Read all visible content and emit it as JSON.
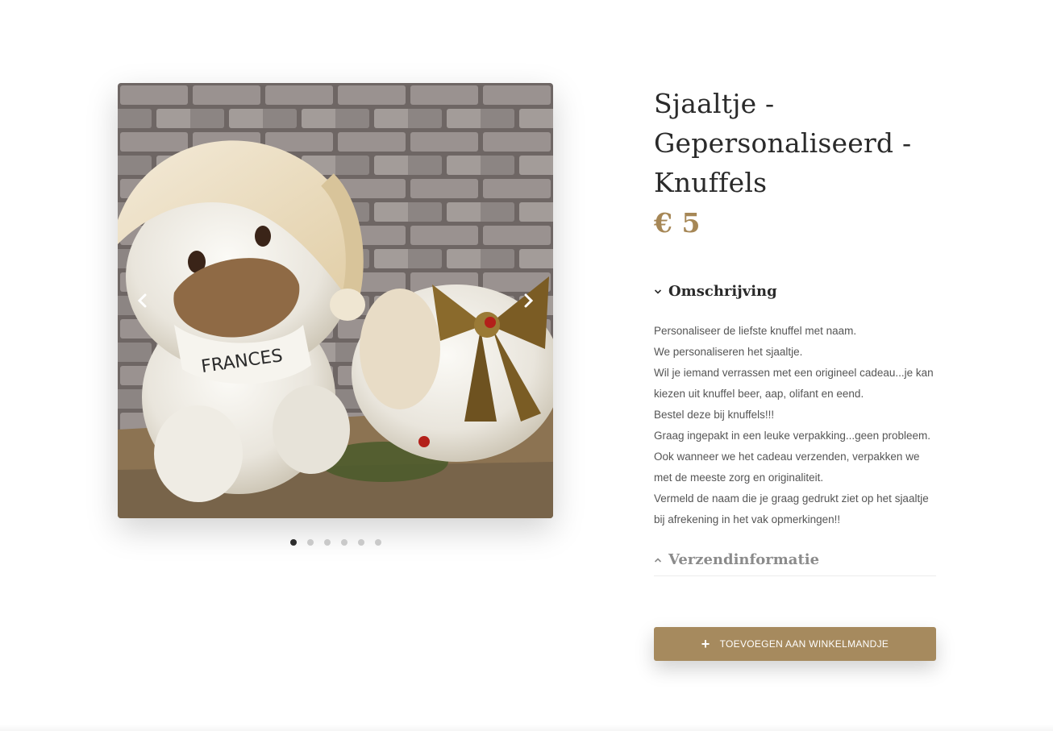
{
  "product": {
    "title_lines": [
      "Sjaaltje -",
      "Gepersonaliseerd -",
      "Knuffels"
    ],
    "price": "€ 5"
  },
  "gallery": {
    "image_text": "FRANCES",
    "active_index": 0,
    "dot_count": 6,
    "prev_icon": "chevron-left-icon",
    "next_icon": "chevron-right-icon"
  },
  "description": {
    "heading": "Omschrijving",
    "expanded": true,
    "lines": [
      "Personaliseer de liefste knuffel met naam.",
      "We personaliseren het sjaaltje.",
      "Wil je iemand verrassen met een origineel cadeau...je kan kiezen uit knuffel beer, aap, olifant en eend.",
      "Bestel deze bij knuffels!!!",
      "Graag ingepakt in een leuke verpakking...geen probleem. Ook wanneer we het cadeau verzenden, verpakken we met de meeste zorg en originaliteit.",
      "Vermeld de naam die je graag gedrukt ziet op het sjaaltje bij afrekening in het vak opmerkingen!!"
    ]
  },
  "shipping": {
    "heading": "Verzendinformatie",
    "expanded": false
  },
  "cart_button": {
    "label": "TOEVOEGEN AAN WINKELMANDJE",
    "icon": "plus-icon"
  },
  "colors": {
    "accent": "#a68a5e",
    "price": "#a68756",
    "dot_active": "#2d2d2d",
    "dot_inactive": "#c9c9c9"
  }
}
